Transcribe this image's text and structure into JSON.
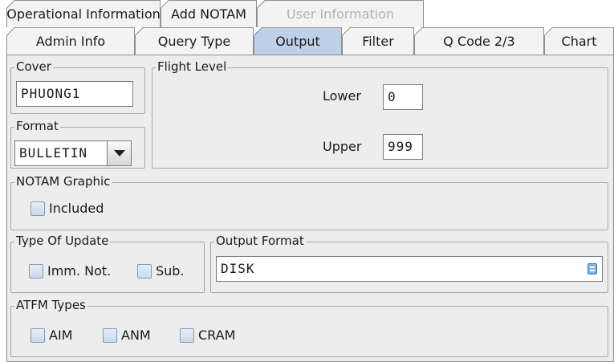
{
  "tabs_row1": [
    {
      "label": "Operational Information",
      "enabled": true
    },
    {
      "label": "Add NOTAM",
      "enabled": true
    },
    {
      "label": "User Information",
      "enabled": false
    }
  ],
  "tabs_row2": [
    {
      "label": "Admin Info"
    },
    {
      "label": "Query Type"
    },
    {
      "label": "Output",
      "selected": true
    },
    {
      "label": "Filter"
    },
    {
      "label": "Q Code 2/3"
    },
    {
      "label": "Chart"
    }
  ],
  "cover": {
    "title": "Cover",
    "value": "PHUONG1"
  },
  "format": {
    "title": "Format",
    "value": "BULLETIN"
  },
  "flight_level": {
    "title": "Flight Level",
    "lower_label": "Lower",
    "lower_value": "0",
    "upper_label": "Upper",
    "upper_value": "999"
  },
  "notam_graphic": {
    "title": "NOTAM Graphic",
    "included_label": "Included",
    "included_checked": false
  },
  "type_of_update": {
    "title": "Type Of Update",
    "imm_not_label": "Imm. Not.",
    "imm_not_checked": false,
    "sub_label": "Sub.",
    "sub_checked": false
  },
  "output_format": {
    "title": "Output Format",
    "value": "DISK",
    "icon": "list-picker-icon"
  },
  "atfm_types": {
    "title": "ATFM Types",
    "aim_label": "AIM",
    "aim_checked": false,
    "anm_label": "ANM",
    "anm_checked": false,
    "cram_label": "CRAM",
    "cram_checked": false
  },
  "colors": {
    "selected_tab": "#bcd1e8",
    "panel_bg": "#ededed",
    "checkbox_border": "#7f9db9"
  }
}
